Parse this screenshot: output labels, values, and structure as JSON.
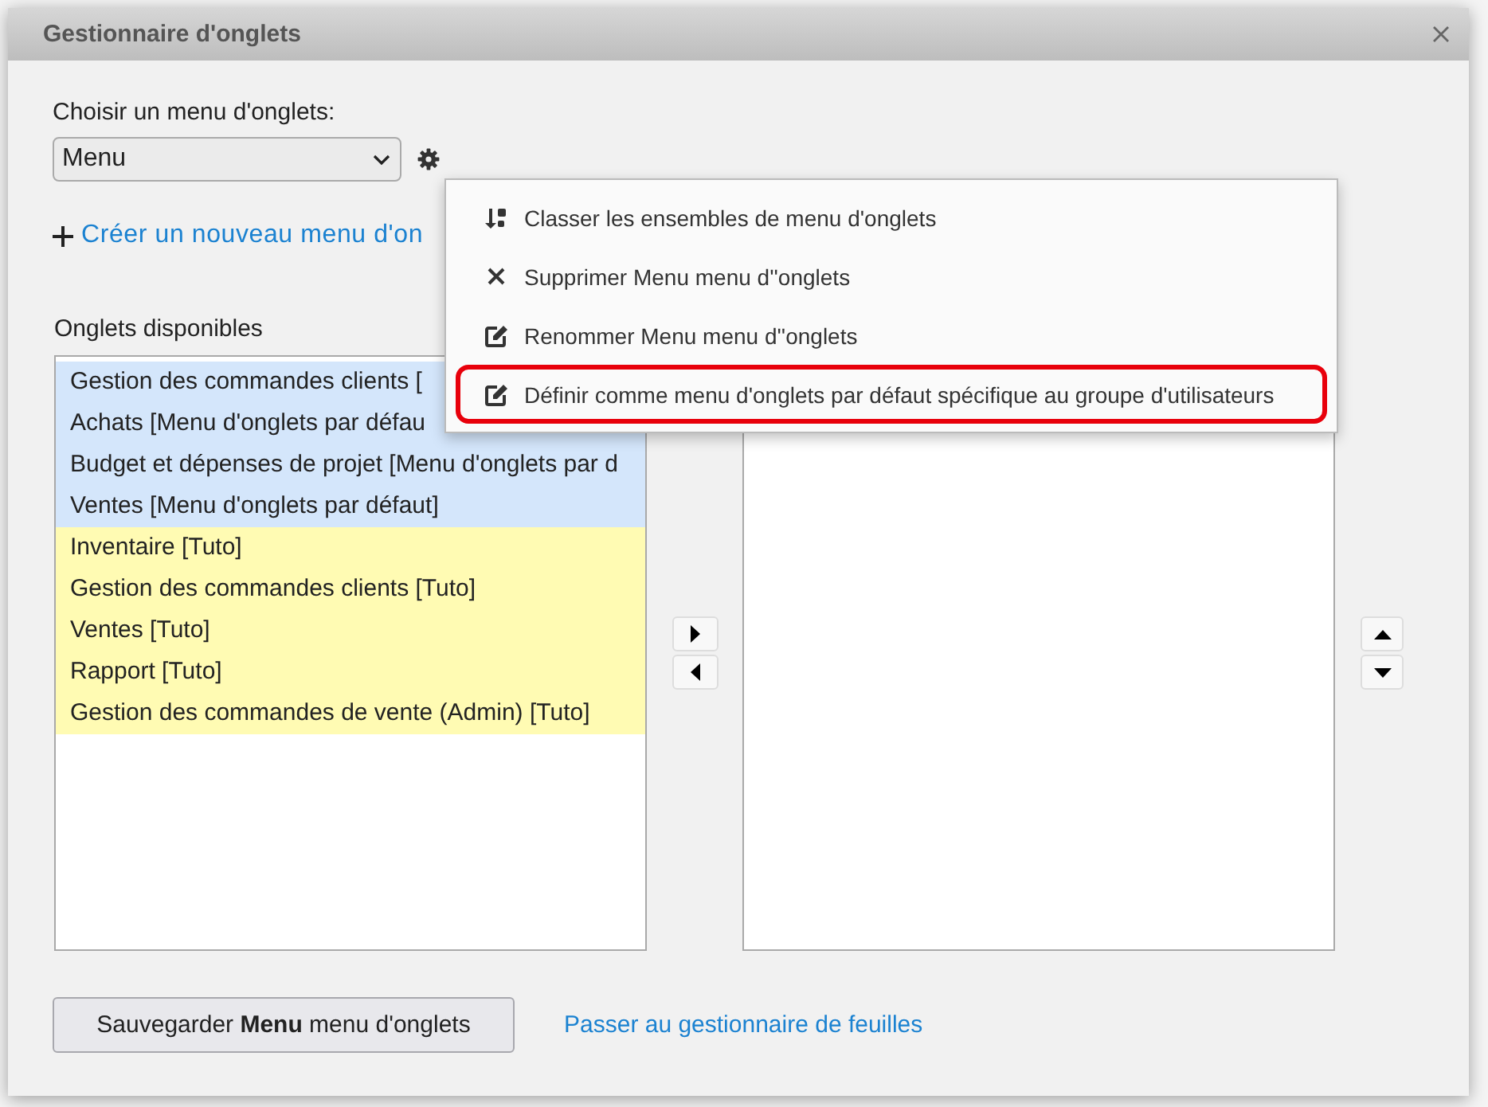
{
  "dialog": {
    "title": "Gestionnaire d'onglets"
  },
  "menu_select": {
    "label": "Choisir un menu d'onglets:",
    "value": "Menu"
  },
  "create_link": {
    "label": "Créer un nouveau menu d'on"
  },
  "available_tabs": {
    "label": "Onglets disponibles",
    "items": [
      {
        "label": "Gestion des commandes clients [",
        "color": "#d4e6fb"
      },
      {
        "label": "Achats [Menu d'onglets par défau",
        "color": "#d4e6fb"
      },
      {
        "label": "Budget et dépenses de projet [Menu d'onglets par d",
        "color": "#d4e6fb"
      },
      {
        "label": "Ventes [Menu d'onglets par défaut]",
        "color": "#d4e6fb"
      },
      {
        "label": "Inventaire [Tuto]",
        "color": "#fffbb3"
      },
      {
        "label": "Gestion des commandes clients [Tuto]",
        "color": "#fffbb3"
      },
      {
        "label": "Ventes [Tuto]",
        "color": "#fffbb3"
      },
      {
        "label": "Rapport [Tuto]",
        "color": "#fffbb3"
      },
      {
        "label": "Gestion des commandes de vente (Admin) [Tuto]",
        "color": "#fffbb3"
      }
    ]
  },
  "context_menu": [
    {
      "kind": "sort",
      "label": "Classer les ensembles de menu d'onglets",
      "highlighted": false
    },
    {
      "kind": "delete",
      "label": "Supprimer Menu menu d''onglets",
      "highlighted": false
    },
    {
      "kind": "edit",
      "label": "Renommer Menu menu d''onglets",
      "highlighted": false
    },
    {
      "kind": "edit",
      "label": "Définir comme menu d'onglets par défaut spécifique au groupe d'utilisateurs",
      "highlighted": true
    }
  ],
  "footer": {
    "save_button": "Sauvegarder **Menu** menu d'onglets",
    "switch_link": "Passer au gestionnaire de feuilles"
  }
}
